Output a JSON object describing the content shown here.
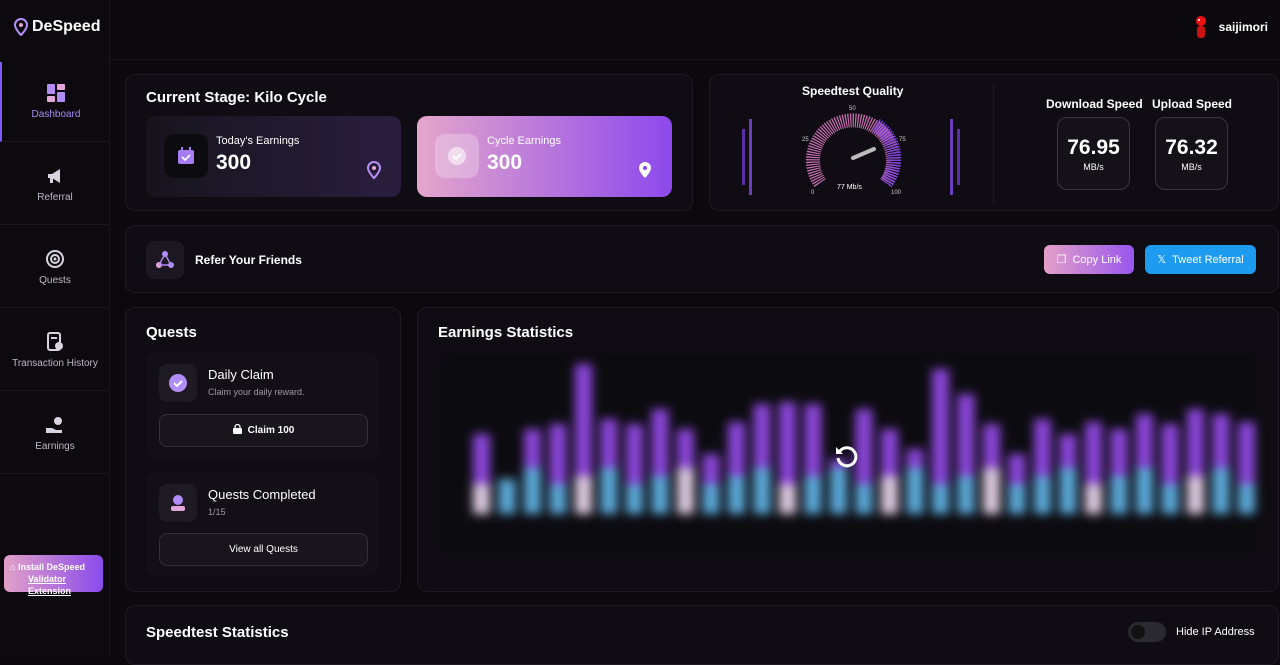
{
  "brand": {
    "name": "DeSpeed"
  },
  "user": {
    "name": "saijimori"
  },
  "sidebar": {
    "items": [
      {
        "label": "Dashboard",
        "icon": "dashboard-icon"
      },
      {
        "label": "Referral",
        "icon": "megaphone-icon"
      },
      {
        "label": "Quests",
        "icon": "target-icon"
      },
      {
        "label": "Transaction History",
        "icon": "receipt-icon"
      },
      {
        "label": "Earnings",
        "icon": "money-hand-icon"
      }
    ],
    "install": {
      "line1": "Install DeSpeed",
      "line2": "Validator Extension"
    }
  },
  "stage": {
    "title": "Current Stage: Kilo Cycle",
    "today": {
      "label": "Today's Earnings",
      "value": "300"
    },
    "cycle": {
      "label": "Cycle Earnings",
      "value": "300"
    }
  },
  "speedtest": {
    "title": "Speedtest Quality",
    "gauge_value": "77 Mb/s",
    "ticks": [
      "0",
      "25",
      "50",
      "75",
      "100"
    ],
    "download": {
      "label": "Download Speed",
      "value": "76.95",
      "unit": "MB/s"
    },
    "upload": {
      "label": "Upload Speed",
      "value": "76.32",
      "unit": "MB/s"
    }
  },
  "refer": {
    "title": "Refer Your Friends",
    "copy_label": "Copy Link",
    "tweet_label": "Tweet Referral"
  },
  "quests": {
    "title": "Quests",
    "daily": {
      "title": "Daily Claim",
      "subtitle": "Claim your daily reward.",
      "button": "Claim 100"
    },
    "completed": {
      "title": "Quests Completed",
      "subtitle": "1/15",
      "button": "View all Quests"
    }
  },
  "earnings": {
    "title": "Earnings Statistics"
  },
  "speedstats": {
    "title": "Speedtest Statistics",
    "toggle_label": "Hide IP Address"
  },
  "colors": {
    "accent": "#8a4bec",
    "pink": "#e2a0c8",
    "blue": "#1d9bf0"
  }
}
